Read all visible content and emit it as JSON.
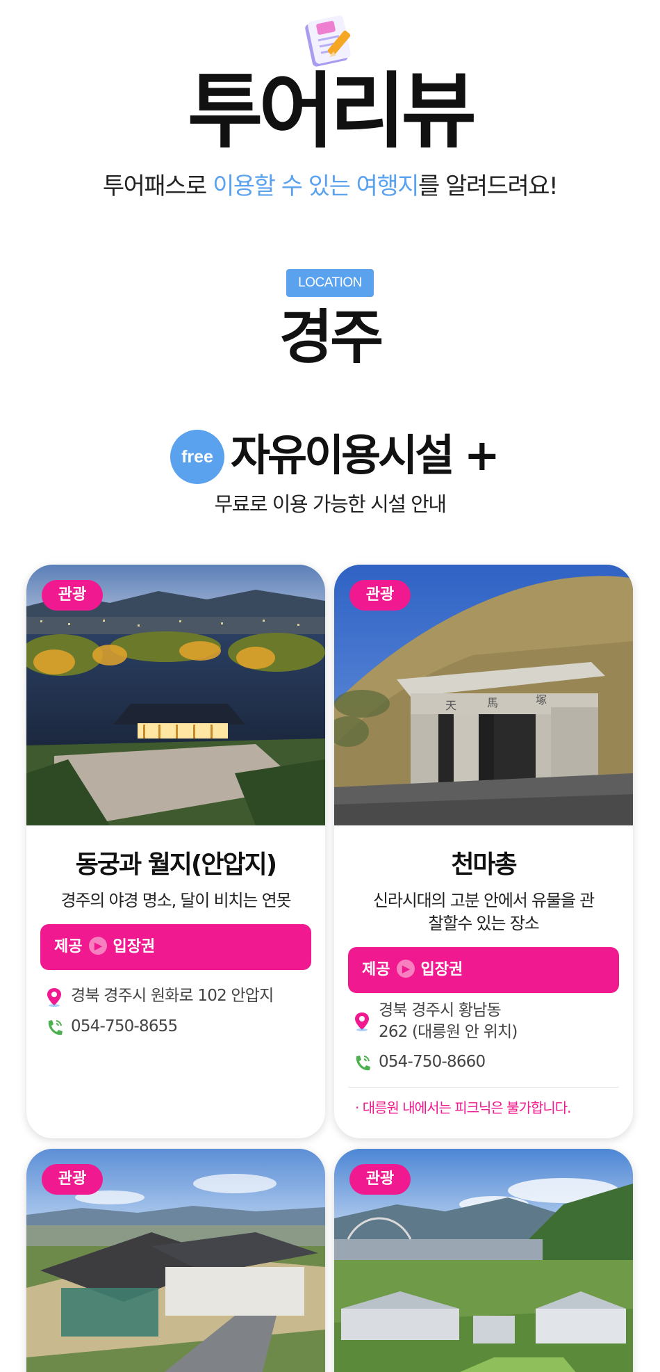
{
  "header": {
    "icon": "notepad-pencil-icon",
    "title": "투어리뷰",
    "subtitle_pre": "투어패스로 ",
    "subtitle_hl": "이용할 수 있는 여행지",
    "subtitle_post": "를 알려드려요!"
  },
  "location": {
    "badge": "LOCATION",
    "city": "경주"
  },
  "free_section": {
    "badge": "free",
    "title": "자유이용시설 +",
    "desc": "무료로 이용 가능한 시설 안내"
  },
  "cards": [
    {
      "category": "관광",
      "name": "동궁과 월지(안압지)",
      "desc": "경주의 야경 명소, 달이 비치는 연못",
      "offer_label": "제공",
      "offer_value": "입장권",
      "address": "경북 경주시 원화로 102 안압지",
      "phone": "054-750-8655"
    },
    {
      "category": "관광",
      "name": "천마총",
      "desc": "신라시대의 고분 안에서 유물을 관찰할수 있는 장소",
      "offer_label": "제공",
      "offer_value": "입장권",
      "address": "경북 경주시 황남동 262 (대릉원 안 위치)",
      "phone": "054-750-8660",
      "note": "· 대릉원 내에서는 피크닉은 불가합니다."
    },
    {
      "category": "관광"
    },
    {
      "category": "관광"
    }
  ],
  "colors": {
    "accent_blue": "#5aa2ee",
    "accent_pink": "#f0198f",
    "text_dark": "#111111"
  },
  "icons": {
    "pin": "map-pin-icon",
    "phone": "phone-icon",
    "arrow": "chevron-right-circle-icon"
  }
}
